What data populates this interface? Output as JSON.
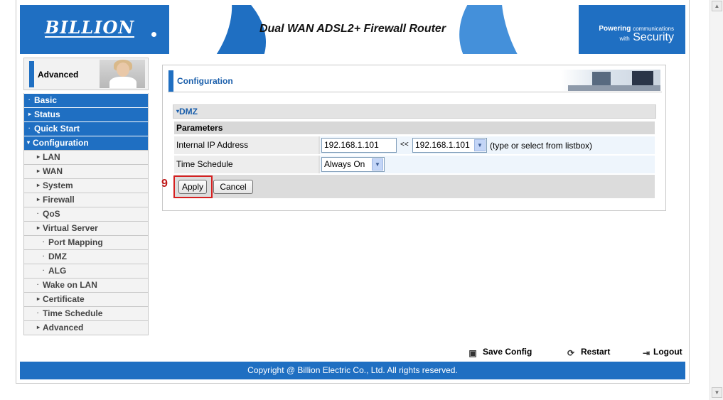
{
  "banner": {
    "logo": "BILLION",
    "title": "Dual WAN ADSL2+ Firewall Router",
    "tagline_bold": "Powering",
    "tagline_small": "communications",
    "tagline_with": "with",
    "tagline_big": "Security"
  },
  "sidebar": {
    "mode_label": "Advanced",
    "items": [
      {
        "label": "Basic",
        "marker": "·"
      },
      {
        "label": "Status",
        "marker": "▸"
      },
      {
        "label": "Quick Start",
        "marker": "·"
      },
      {
        "label": "Configuration",
        "marker": "▾"
      },
      {
        "label": "LAN",
        "marker": "▸"
      },
      {
        "label": "WAN",
        "marker": "▸"
      },
      {
        "label": "System",
        "marker": "▸"
      },
      {
        "label": "Firewall",
        "marker": "▸"
      },
      {
        "label": "QoS",
        "marker": "·"
      },
      {
        "label": "Virtual Server",
        "marker": "▸"
      },
      {
        "label": "Port Mapping",
        "marker": "·"
      },
      {
        "label": "DMZ",
        "marker": "·"
      },
      {
        "label": "ALG",
        "marker": "·"
      },
      {
        "label": "Wake on LAN",
        "marker": "·"
      },
      {
        "label": "Certificate",
        "marker": "▸"
      },
      {
        "label": "Time Schedule",
        "marker": "·"
      },
      {
        "label": "Advanced",
        "marker": "▸"
      }
    ]
  },
  "content": {
    "title": "Configuration",
    "section": "DMZ",
    "params_heading": "Parameters",
    "ip_label": "Internal IP Address",
    "ip_value": "192.168.1.101",
    "ip_sep": "<<",
    "ip_select": "192.168.1.101",
    "ip_hint": "(type or select from listbox)",
    "schedule_label": "Time Schedule",
    "schedule_value": "Always On",
    "apply_label": "Apply",
    "cancel_label": "Cancel",
    "step_marker": "9"
  },
  "actions": {
    "save": "Save Config",
    "restart": "Restart",
    "logout": "Logout"
  },
  "footer": {
    "copyright": "Copyright @ Billion Electric Co., Ltd. All rights reserved."
  },
  "colors": {
    "brand_blue": "#1f6fc2",
    "highlight_red": "#d62020"
  }
}
